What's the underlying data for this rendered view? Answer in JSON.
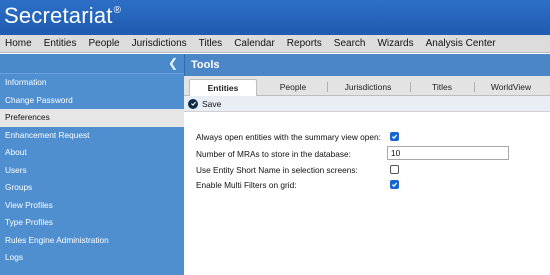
{
  "app": {
    "brand_name": "Secretariat",
    "brand_mark": "®"
  },
  "menu": {
    "items": [
      {
        "label": "Home"
      },
      {
        "label": "Entities"
      },
      {
        "label": "People"
      },
      {
        "label": "Jurisdictions"
      },
      {
        "label": "Titles"
      },
      {
        "label": "Calendar"
      },
      {
        "label": "Reports"
      },
      {
        "label": "Search"
      },
      {
        "label": "Wizards"
      },
      {
        "label": "Analysis Center"
      }
    ]
  },
  "sidebar": {
    "collapse_icon": "chevron-left-icon",
    "active_item": "Preferences",
    "items": [
      {
        "label": "Information"
      },
      {
        "label": "Change Password"
      },
      {
        "label": "Preferences"
      },
      {
        "label": "Enhancement Request"
      },
      {
        "label": "About"
      },
      {
        "label": "Users"
      },
      {
        "label": "Groups"
      },
      {
        "label": "View Profiles"
      },
      {
        "label": "Type Profiles"
      },
      {
        "label": "Rules Engine Administration"
      },
      {
        "label": "Logs"
      }
    ]
  },
  "content": {
    "title": "Tools",
    "active_tab": "Entities",
    "tabs": [
      {
        "label": "Entities"
      },
      {
        "label": "People"
      },
      {
        "label": "Jurisdictions"
      },
      {
        "label": "Titles"
      },
      {
        "label": "WorldView"
      }
    ],
    "toolbar": {
      "save_label": "Save",
      "save_icon": "save-icon"
    },
    "form": {
      "summary_view_label": "Always open entities with the summary view open:",
      "summary_view_checked": true,
      "mras_label": "Number of MRAs to store in the database:",
      "mras_value": "10",
      "short_name_label": "Use Entity Short Name in selection screens:",
      "short_name_checked": false,
      "multi_filters_label": "Enable Multi Filters on grid:",
      "multi_filters_checked": true
    }
  },
  "colors": {
    "brand_bar": "#1f5bb0",
    "sidebar_bg": "#4f8fcf",
    "content_header": "#4b87c6",
    "checkbox_blue": "#1a66d1"
  }
}
